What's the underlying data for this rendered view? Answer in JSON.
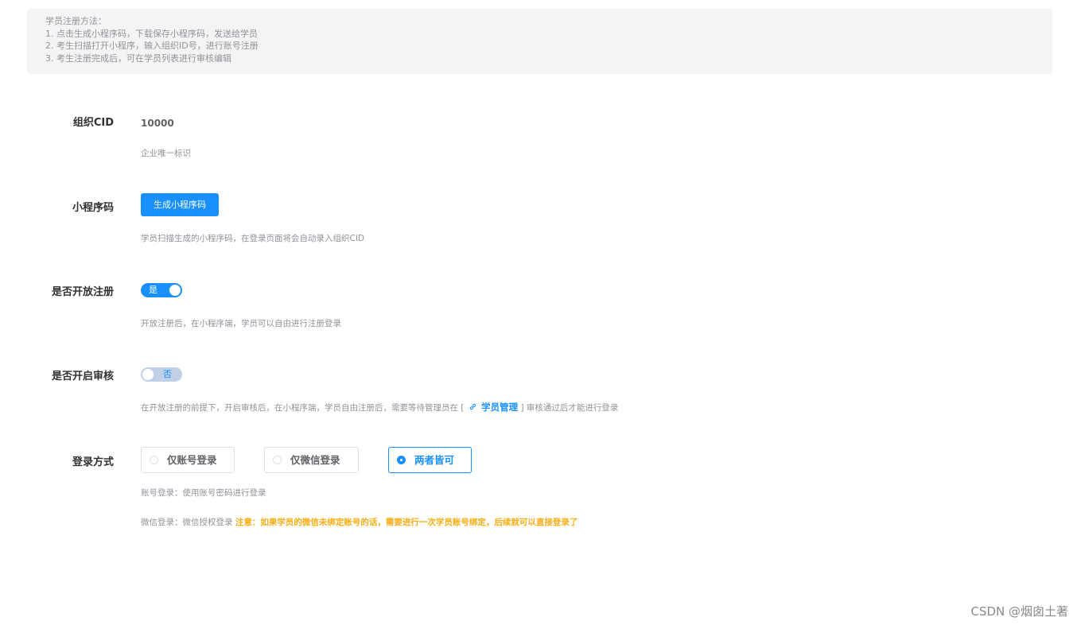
{
  "notice": {
    "title": "学员注册方法：",
    "steps": [
      "1. 点击生成小程序码，下载保存小程序码，发送给学员",
      "2. 考生扫描打开小程序，输入组织ID号，进行账号注册",
      "3. 考生注册完成后，可在学员列表进行审核编辑"
    ]
  },
  "cid": {
    "label": "组织CID",
    "value": "10000",
    "hint": "企业唯一标识"
  },
  "miniprogram": {
    "label": "小程序码",
    "button": "生成小程序码",
    "hint": "学员扫描生成的小程序码，在登录页面将会自动录入组织CID"
  },
  "open_register": {
    "label": "是否开放注册",
    "state": "on",
    "switch_text": "是",
    "hint": "开放注册后，在小程序端，学员可以自由进行注册登录"
  },
  "audit": {
    "label": "是否开启审核",
    "state": "off",
    "switch_text": "否",
    "hint_before": "在开放注册的前提下，开启审核后，在小程序端，学员自由注册后，需要等待管理员在 [",
    "link_text": "学员管理",
    "hint_after": "] 审核通过后才能进行登录"
  },
  "login": {
    "label": "登录方式",
    "options": [
      {
        "label": "仅账号登录",
        "checked": false
      },
      {
        "label": "仅微信登录",
        "checked": false
      },
      {
        "label": "两者皆可",
        "checked": true
      }
    ],
    "hint_account": "账号登录：使用账号密码进行登录",
    "hint_wechat": "微信登录：微信授权登录",
    "warning": "注意：如果学员的微信未绑定账号的话，需要进行一次学员账号绑定，后续就可以直接登录了"
  },
  "watermark": "CSDN @烟囱土著",
  "colors": {
    "primary": "#1890ff",
    "warning": "#faad14",
    "notice_bg": "#f4f4f5"
  }
}
